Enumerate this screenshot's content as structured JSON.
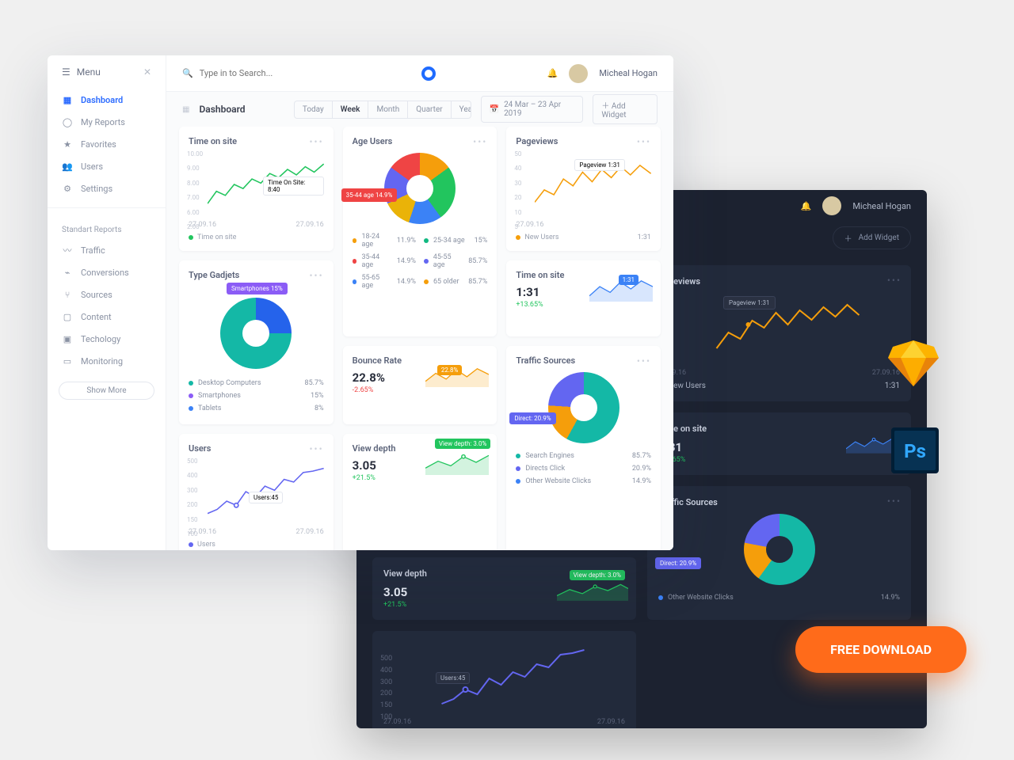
{
  "user": {
    "name": "Micheal Hogan"
  },
  "menu": {
    "label": "Menu"
  },
  "sidebar": {
    "items": [
      {
        "label": "Dashboard",
        "icon": "grid"
      },
      {
        "label": "My Reports",
        "icon": "user"
      },
      {
        "label": "Favorites",
        "icon": "star"
      },
      {
        "label": "Users",
        "icon": "people"
      },
      {
        "label": "Settings",
        "icon": "gear"
      }
    ],
    "section_label": "Standart Reports",
    "reports": [
      {
        "label": "Traffic"
      },
      {
        "label": "Conversions"
      },
      {
        "label": "Sources"
      },
      {
        "label": "Content"
      },
      {
        "label": "Techology"
      },
      {
        "label": "Monitoring"
      }
    ],
    "show_more": "Show More"
  },
  "search": {
    "placeholder": "Type in to Search..."
  },
  "page": {
    "title": "Dashboard"
  },
  "range_tabs": [
    "Today",
    "Week",
    "Month",
    "Quarter",
    "Year"
  ],
  "range_active": "Week",
  "date_range": "24 Mar – 23 Apr 2019",
  "add_widget": "Add Widget",
  "cards": {
    "time_on_site": {
      "title": "Time on site",
      "tooltip": "Time On Site: 8:40",
      "y_ticks": [
        "10.00",
        "9.00",
        "8.00",
        "7.00",
        "6.00",
        "2.00"
      ],
      "footer_left": "27.09.16",
      "footer_right": "27.09.16",
      "legend": "Time on site"
    },
    "age_users": {
      "title": "Age Users",
      "badge": "35-44 age 14.9%",
      "rows": [
        {
          "k": "18-24 age",
          "v": "11.9%",
          "c": "#f59e0b"
        },
        {
          "k": "25-34 age",
          "v": "15%",
          "c": "#10b981"
        },
        {
          "k": "35-44 age",
          "v": "14.9%",
          "c": "#ef4444"
        },
        {
          "k": "45-55 age",
          "v": "85.7%",
          "c": "#6366f1"
        },
        {
          "k": "55-65 age",
          "v": "14.9%",
          "c": "#3b82f6"
        },
        {
          "k": "65 older",
          "v": "85.7%",
          "c": "#f59e0b"
        }
      ]
    },
    "pageviews": {
      "title": "Pageviews",
      "tooltip": "Pageview 1:31",
      "y_ticks": [
        "50",
        "40",
        "30",
        "20",
        "10",
        "5"
      ],
      "footer_left": "27.09.16",
      "legend": "New Users",
      "legend_val": "1:31"
    },
    "type_gadgets": {
      "title": "Type Gadjets",
      "tag": "Smartphones 15%",
      "rows": [
        {
          "k": "Desktop Computers",
          "v": "85.7%",
          "c": "#14b8a6"
        },
        {
          "k": "Smartphones",
          "v": "15%",
          "c": "#8b5cf6"
        },
        {
          "k": "Tablets",
          "v": "8%",
          "c": "#3b82f6"
        }
      ]
    },
    "bounce_rate": {
      "title": "Bounce Rate",
      "value": "22.8%",
      "delta": "-2.65%",
      "tag": "22.8%"
    },
    "time_small": {
      "title": "Time on site",
      "value": "1:31",
      "delta": "+13.65%",
      "tag": "1:31"
    },
    "users": {
      "title": "Users",
      "tooltip": "Users:45",
      "y_ticks": [
        "500",
        "400",
        "300",
        "200",
        "150",
        "100"
      ],
      "footer_left": "27.09.16",
      "footer_right": "27.09.16",
      "legend": "Users"
    },
    "view_depth": {
      "title": "View depth",
      "value": "3.05",
      "delta": "+21.5%",
      "tag": "View depth: 3.0%"
    },
    "traffic_sources": {
      "title": "Traffic Sources",
      "tag": "Direct: 20.9%",
      "rows": [
        {
          "k": "Search Engines",
          "v": "85.7%",
          "c": "#14b8a6"
        },
        {
          "k": "Directs Click",
          "v": "20.9%",
          "c": "#6366f1"
        },
        {
          "k": "Other Website Clicks",
          "v": "14.9%",
          "c": "#3b82f6"
        }
      ]
    }
  },
  "cta": "FREE DOWNLOAD",
  "chart_data": [
    {
      "type": "line",
      "name": "time_on_site",
      "ylim": [
        2,
        10
      ],
      "values": [
        3,
        5,
        4,
        6,
        7,
        6.5,
        8,
        7.5,
        8.4,
        8.2,
        9,
        8.6,
        9.2
      ]
    },
    {
      "type": "pie",
      "name": "age_users",
      "series": [
        {
          "name": "18-24",
          "value": 11.9
        },
        {
          "name": "25-34",
          "value": 15
        },
        {
          "name": "35-44",
          "value": 14.9
        },
        {
          "name": "45-55",
          "value": 85.7
        },
        {
          "name": "55-65",
          "value": 14.9
        },
        {
          "name": "65+",
          "value": 85.7
        }
      ]
    },
    {
      "type": "line",
      "name": "pageviews",
      "ylim": [
        5,
        50
      ],
      "values": [
        10,
        22,
        18,
        34,
        28,
        40,
        30,
        44,
        36,
        46,
        38,
        48
      ]
    },
    {
      "type": "pie",
      "name": "type_gadgets",
      "series": [
        {
          "name": "Desktop",
          "value": 85.7
        },
        {
          "name": "Smartphones",
          "value": 15
        },
        {
          "name": "Tablets",
          "value": 8
        }
      ]
    },
    {
      "type": "area",
      "name": "bounce_rate",
      "values": [
        18,
        26,
        22,
        30,
        22.8,
        27,
        24,
        29
      ]
    },
    {
      "type": "area",
      "name": "time_small",
      "values": [
        1.1,
        1.5,
        1.2,
        1.6,
        1.31,
        1.7,
        1.4
      ]
    },
    {
      "type": "line",
      "name": "users",
      "ylim": [
        100,
        500
      ],
      "values": [
        120,
        150,
        210,
        180,
        300,
        260,
        340,
        310,
        400,
        380,
        460,
        480
      ]
    },
    {
      "type": "area",
      "name": "view_depth",
      "values": [
        2.4,
        3.1,
        2.8,
        3.2,
        3.05,
        3.4
      ]
    },
    {
      "type": "pie",
      "name": "traffic_sources",
      "series": [
        {
          "name": "Search",
          "value": 85.7
        },
        {
          "name": "Direct",
          "value": 20.9
        },
        {
          "name": "Other",
          "value": 14.9
        }
      ]
    }
  ]
}
